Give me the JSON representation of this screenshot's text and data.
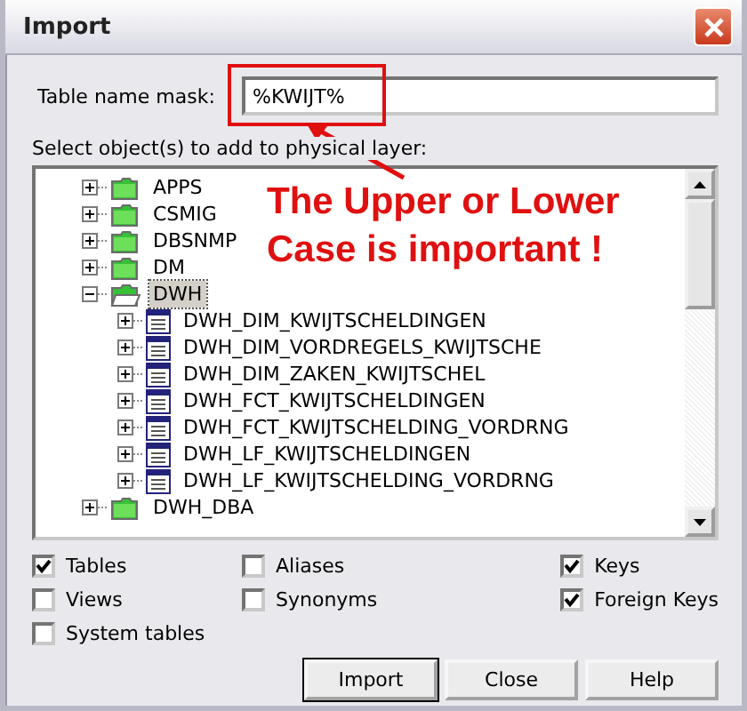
{
  "window": {
    "title": "Import"
  },
  "mask": {
    "label": "Table name mask:",
    "value": "%KWIJT%"
  },
  "tree": {
    "label": "Select object(s) to add to physical layer:",
    "items": [
      {
        "kind": "folder",
        "label": "APPS",
        "expanded": false,
        "selected": false
      },
      {
        "kind": "folder",
        "label": "CSMIG",
        "expanded": false,
        "selected": false
      },
      {
        "kind": "folder",
        "label": "DBSNMP",
        "expanded": false,
        "selected": false
      },
      {
        "kind": "folder",
        "label": "DM",
        "expanded": false,
        "selected": false
      },
      {
        "kind": "folder",
        "label": "DWH",
        "expanded": true,
        "selected": true,
        "children": [
          {
            "kind": "table",
            "label": "DWH_DIM_KWIJTSCHELDINGEN",
            "expanded": false,
            "selected": false
          },
          {
            "kind": "table",
            "label": "DWH_DIM_VORDREGELS_KWIJTSCHE",
            "expanded": false,
            "selected": false
          },
          {
            "kind": "table",
            "label": "DWH_DIM_ZAKEN_KWIJTSCHEL",
            "expanded": false,
            "selected": false
          },
          {
            "kind": "table",
            "label": "DWH_FCT_KWIJTSCHELDINGEN",
            "expanded": false,
            "selected": false
          },
          {
            "kind": "table",
            "label": "DWH_FCT_KWIJTSCHELDING_VORDRNG",
            "expanded": false,
            "selected": false
          },
          {
            "kind": "table",
            "label": "DWH_LF_KWIJTSCHELDINGEN",
            "expanded": false,
            "selected": false
          },
          {
            "kind": "table",
            "label": "DWH_LF_KWIJTSCHELDING_VORDRNG",
            "expanded": false,
            "selected": false
          }
        ]
      },
      {
        "kind": "folder",
        "label": "DWH_DBA",
        "expanded": false,
        "selected": false
      }
    ]
  },
  "options": [
    {
      "label": "Tables",
      "checked": true
    },
    {
      "label": "Aliases",
      "checked": false
    },
    {
      "label": "Keys",
      "checked": true
    },
    {
      "label": "Views",
      "checked": false
    },
    {
      "label": "Synonyms",
      "checked": false
    },
    {
      "label": "Foreign Keys",
      "checked": true
    },
    {
      "label": "System tables",
      "checked": false
    }
  ],
  "buttons": [
    {
      "label": "Import",
      "default": true
    },
    {
      "label": "Close",
      "default": false
    },
    {
      "label": "Help",
      "default": false
    }
  ],
  "annotation": {
    "lines": [
      "The Upper or Lower",
      "Case is important !"
    ]
  }
}
